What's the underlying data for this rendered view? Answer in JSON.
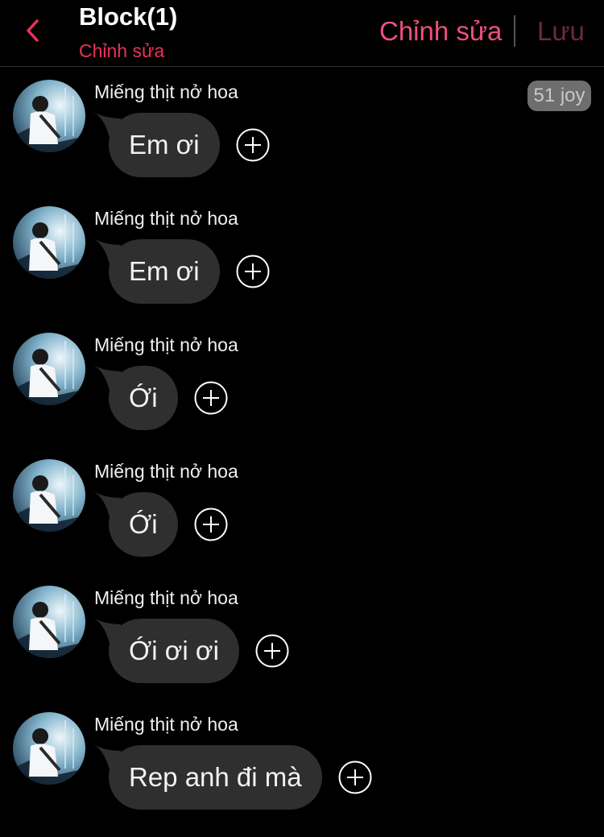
{
  "header": {
    "title": "Block(1)",
    "subtitle": "Chỉnh sửa",
    "edit_label": "Chỉnh sửa",
    "save_label": "Lưu"
  },
  "joy_badge": "51 joy",
  "colors": {
    "accent": "#e8335b",
    "background": "#000000",
    "bubble": "#2f2f2f",
    "badge": "#6e6e6e"
  },
  "messages": [
    {
      "sender": "Miếng thịt nở hoa",
      "text": "Em ơi"
    },
    {
      "sender": "Miếng thịt nở hoa",
      "text": "Em ơi"
    },
    {
      "sender": "Miếng thịt nở hoa",
      "text": "Ới"
    },
    {
      "sender": "Miếng thịt nở hoa",
      "text": "Ới"
    },
    {
      "sender": "Miếng thịt nở hoa",
      "text": "Ới ơi ơi"
    },
    {
      "sender": "Miếng thịt nở hoa",
      "text": "Rep anh đi mà"
    }
  ]
}
